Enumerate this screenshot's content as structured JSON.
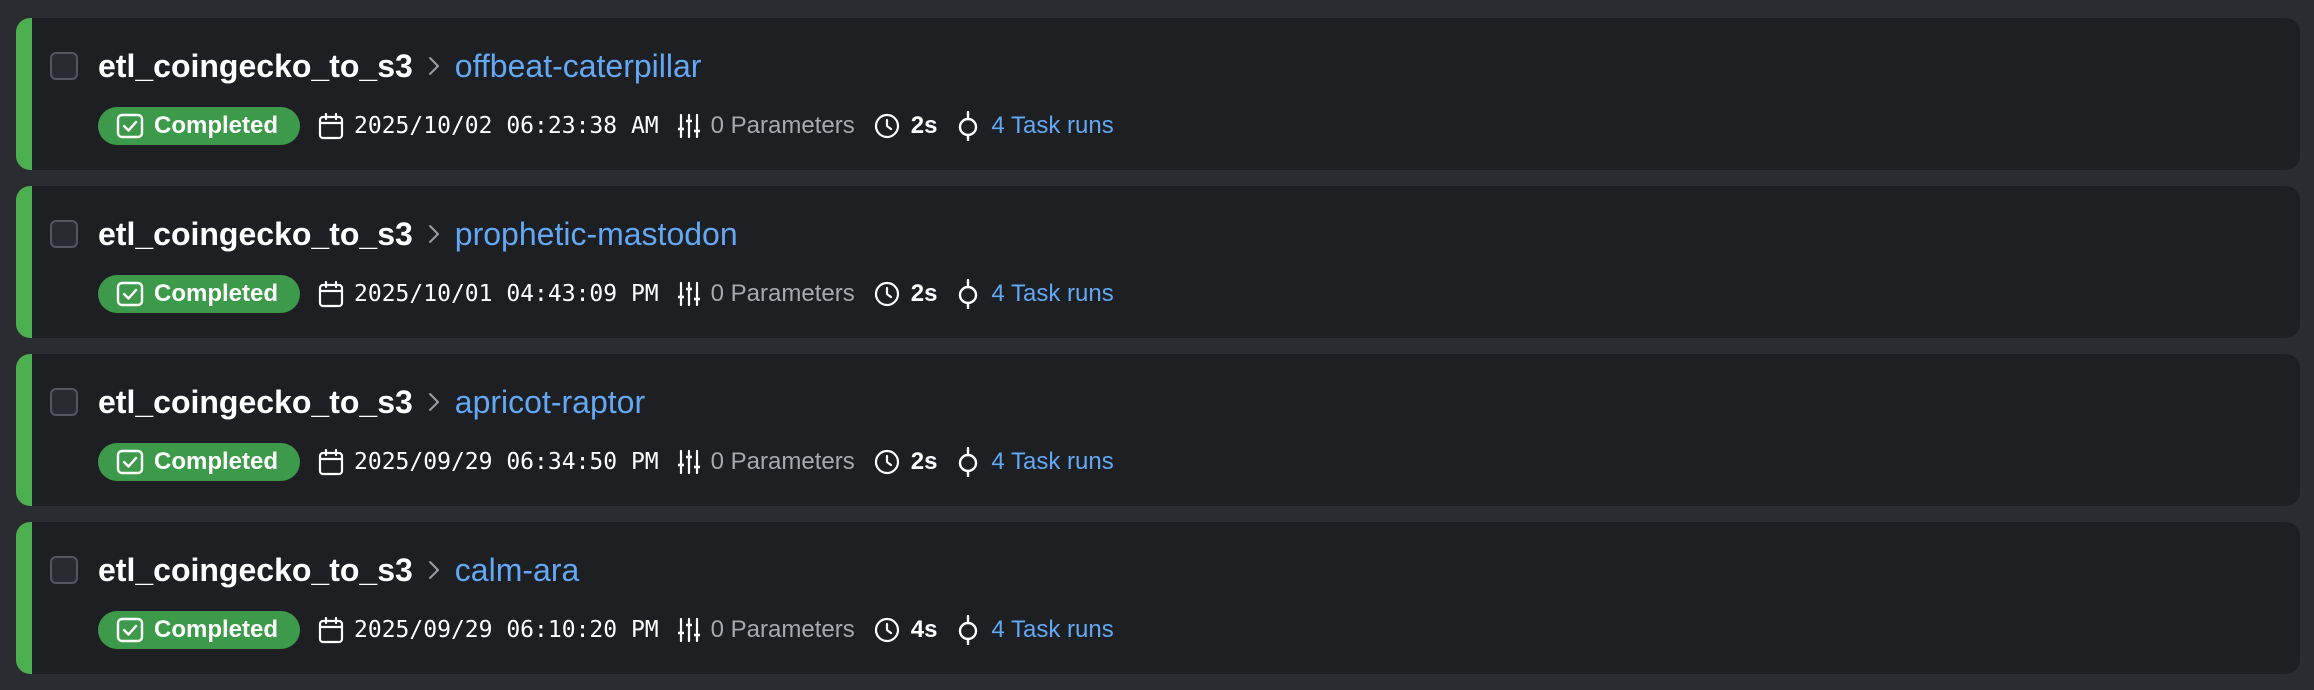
{
  "colors": {
    "accent_completed": "#4caf50",
    "badge_completed": "#3d9a4a",
    "link": "#62a8f5",
    "row_bg": "#1e1f23",
    "page_bg": "#2b2c31"
  },
  "icons": {
    "status": "check-square-icon",
    "date": "calendar-icon",
    "params": "sliders-icon",
    "duration": "clock-icon",
    "tasks": "task-run-icon",
    "separator": "chevron-right-icon"
  },
  "runs": [
    {
      "flow_name": "etl_coingecko_to_s3",
      "run_name": "offbeat-caterpillar",
      "status": "Completed",
      "date": "2025/10/02 06:23:38 AM",
      "parameters": "0 Parameters",
      "duration": "2s",
      "task_runs": "4 Task runs"
    },
    {
      "flow_name": "etl_coingecko_to_s3",
      "run_name": "prophetic-mastodon",
      "status": "Completed",
      "date": "2025/10/01 04:43:09 PM",
      "parameters": "0 Parameters",
      "duration": "2s",
      "task_runs": "4 Task runs"
    },
    {
      "flow_name": "etl_coingecko_to_s3",
      "run_name": "apricot-raptor",
      "status": "Completed",
      "date": "2025/09/29 06:34:50 PM",
      "parameters": "0 Parameters",
      "duration": "2s",
      "task_runs": "4 Task runs"
    },
    {
      "flow_name": "etl_coingecko_to_s3",
      "run_name": "calm-ara",
      "status": "Completed",
      "date": "2025/09/29 06:10:20 PM",
      "parameters": "0 Parameters",
      "duration": "4s",
      "task_runs": "4 Task runs"
    }
  ]
}
